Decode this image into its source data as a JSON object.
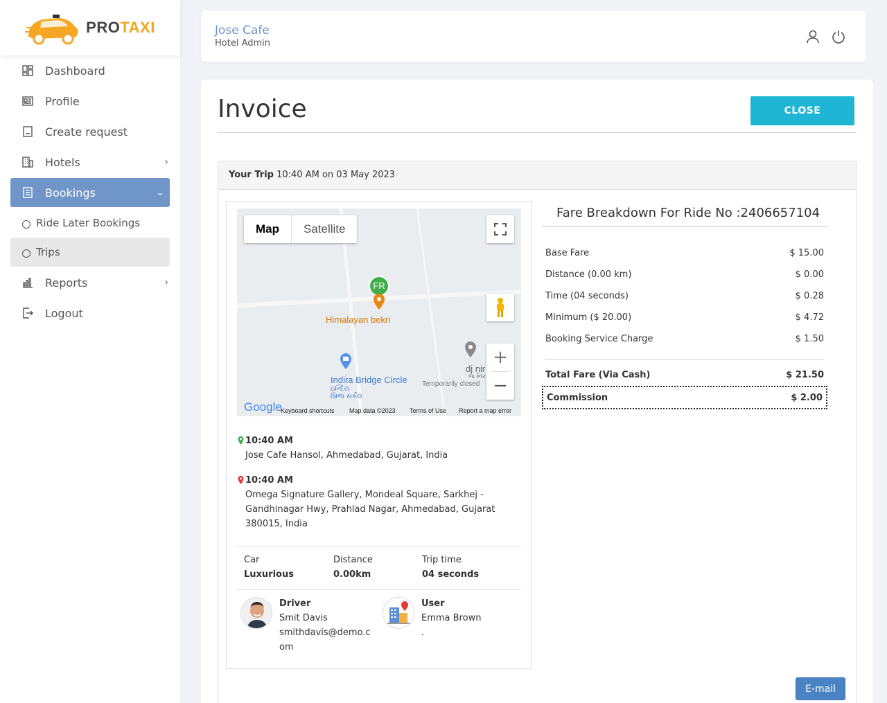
{
  "brand": {
    "pro": "PRO",
    "taxi": "TAXI"
  },
  "sidebar": {
    "items": [
      {
        "label": "Dashboard",
        "icon": "dashboard-icon"
      },
      {
        "label": "Profile",
        "icon": "profile-icon"
      },
      {
        "label": "Create request",
        "icon": "create-request-icon"
      },
      {
        "label": "Hotels",
        "icon": "hotels-icon"
      },
      {
        "label": "Bookings",
        "icon": "bookings-icon"
      },
      {
        "label": "Ride Later Bookings",
        "icon": "circle-icon"
      },
      {
        "label": "Trips",
        "icon": "circle-icon"
      },
      {
        "label": "Reports",
        "icon": "reports-icon"
      },
      {
        "label": "Logout",
        "icon": "logout-icon"
      }
    ]
  },
  "header": {
    "name": "Jose Cafe",
    "role": "Hotel Admin"
  },
  "page": {
    "title": "Invoice",
    "close_label": "CLOSE"
  },
  "trip": {
    "label": "Your Trip",
    "datetime": "10:40 AM on 03 May 2023"
  },
  "map": {
    "tab_map": "Map",
    "tab_satellite": "Satellite",
    "marker_label": "FR",
    "place1": "Himalayan bekri",
    "place2": "Indira Bridge Circle",
    "place2_sub1": "ઇન્દિરા",
    "place2_sub2": "બ્રિજ સર્કલ",
    "place3": "dj nir",
    "place3_sub": "જ નિર",
    "place3_status": "Temporarily closed",
    "google": "Google",
    "footer_shortcuts": "Keyboard shortcuts",
    "footer_data": "Map data ©2023",
    "footer_terms": "Terms of Use",
    "footer_report": "Report a map error"
  },
  "pickup": {
    "time": "10:40 AM",
    "address": "Jose Cafe Hansol, Ahmedabad, Gujarat, India"
  },
  "dropoff": {
    "time": "10:40 AM",
    "address": "Omega Signature Gallery, Mondeal Square, Sarkhej - Gandhinagar Hwy, Prahlad Nagar, Ahmedabad, Gujarat 380015, India"
  },
  "stats": {
    "car_label": "Car",
    "car_value": "Luxurious",
    "distance_label": "Distance",
    "distance_value": "0.00km",
    "time_label": "Trip time",
    "time_value": "04 seconds"
  },
  "driver": {
    "role": "Driver",
    "name": "Smit Davis",
    "email": "smithdavis@demo.c",
    "email2": "om"
  },
  "user": {
    "role": "User",
    "name": "Emma Brown",
    "extra": "."
  },
  "fare": {
    "title": "Fare Breakdown For Ride No :2406657104",
    "rows": [
      {
        "label": "Base Fare",
        "amount": "$ 15.00"
      },
      {
        "label": "Distance (0.00 km)",
        "amount": "$ 0.00"
      },
      {
        "label": "Time (04 seconds)",
        "amount": "$ 0.28"
      },
      {
        "label": "Minimum ($ 20.00)",
        "amount": "$ 4.72"
      },
      {
        "label": "Booking Service Charge",
        "amount": "$ 1.50"
      }
    ],
    "total_label": "Total Fare (Via Cash)",
    "total_amount": "$ 21.50",
    "commission_label": "Commission",
    "commission_amount": "$ 2.00"
  },
  "email_label": "E-mail",
  "colors": {
    "accent": "#6f95c9",
    "close": "#1fb6d6",
    "email": "#4a83c4",
    "logo": "#f5a623"
  }
}
